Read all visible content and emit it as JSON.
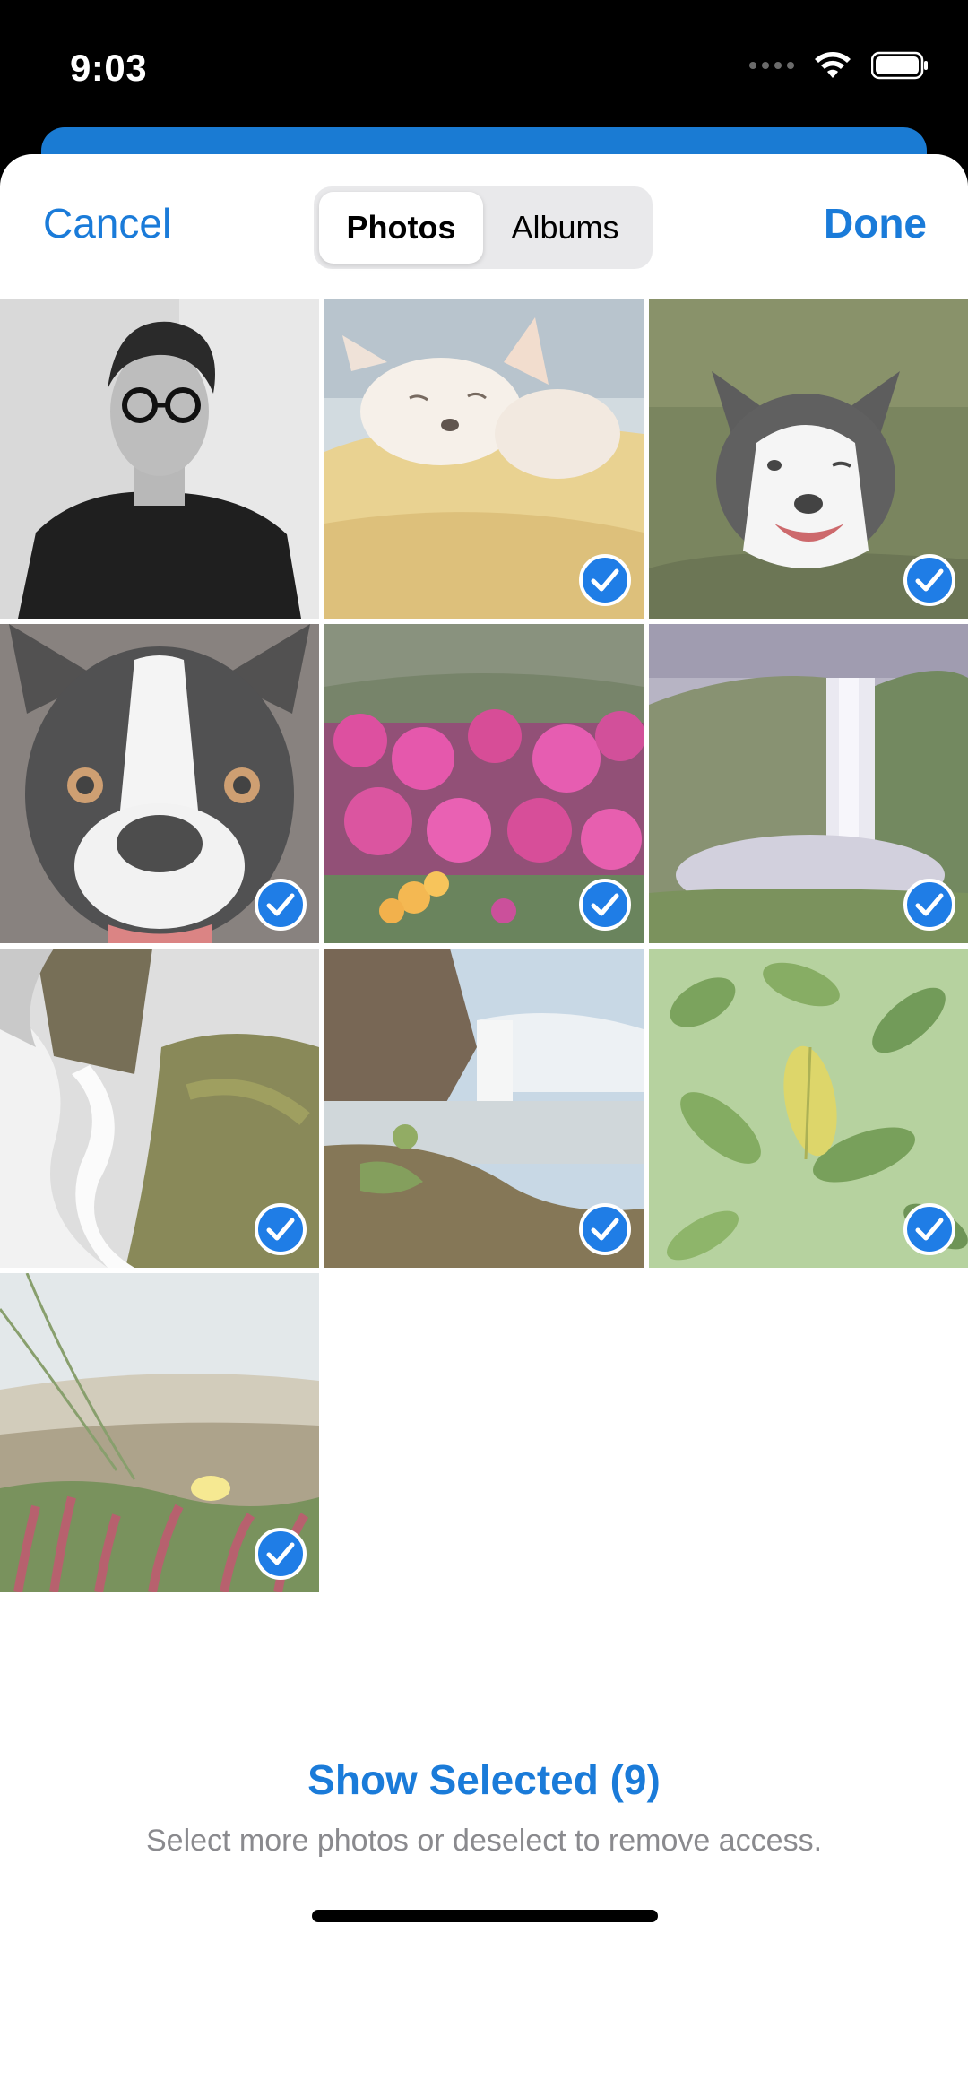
{
  "status_bar": {
    "time": "9:03",
    "icons": [
      "signal-dots-icon",
      "wifi-icon",
      "battery-icon"
    ]
  },
  "nav": {
    "cancel_label": "Cancel",
    "done_label": "Done",
    "segments": [
      {
        "label": "Photos",
        "selected": true
      },
      {
        "label": "Albums",
        "selected": false
      }
    ]
  },
  "photos": [
    {
      "subject": "portrait-man",
      "selected": false
    },
    {
      "subject": "chihuahua",
      "selected": true
    },
    {
      "subject": "husky",
      "selected": true
    },
    {
      "subject": "boston-terrier",
      "selected": true
    },
    {
      "subject": "pink-flowers",
      "selected": true
    },
    {
      "subject": "waterfall-valley",
      "selected": true
    },
    {
      "subject": "waterfall-rocks",
      "selected": true
    },
    {
      "subject": "waterfall-coast",
      "selected": true
    },
    {
      "subject": "green-leaves",
      "selected": true
    },
    {
      "subject": "beach-plants",
      "selected": true
    }
  ],
  "footer": {
    "show_selected_label": "Show Selected (9)",
    "helper_text": "Select more photos or deselect to remove access."
  },
  "colors": {
    "accent": "#1a7bd9",
    "check_blue": "#1f7de6",
    "sheet_bg": "#ffffff",
    "segment_bg": "#e9e9eb",
    "helper_text": "#8a8a8e"
  }
}
